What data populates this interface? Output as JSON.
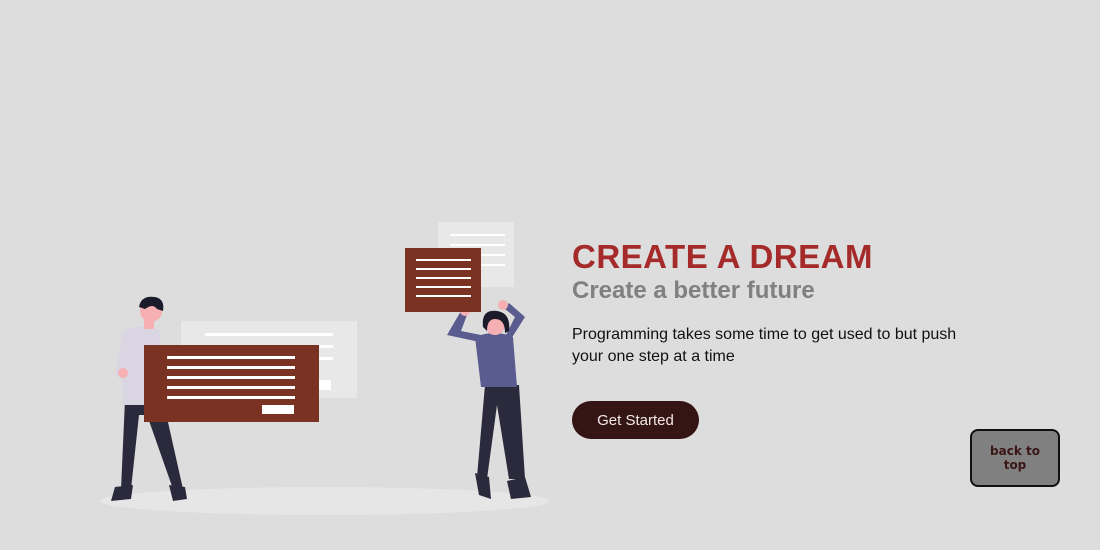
{
  "hero": {
    "title": "CREATE A DREAM",
    "subtitle": "Create a better future",
    "description": "Programming takes some time to get used to but push your one step at a time",
    "cta_label": "Get Started"
  },
  "back_to_top_label": "back to top",
  "colors": {
    "background": "#dddddd",
    "title": "#a52a2a",
    "subtitle": "#808080",
    "cta_background": "#351414",
    "card": "#7a3323",
    "figure_shirt": "#5a5b8f",
    "figure_pants": "#2b2a3c",
    "back_to_top_background": "#808080"
  },
  "illustration": {
    "icon": "two-people-with-documents-illustration"
  }
}
